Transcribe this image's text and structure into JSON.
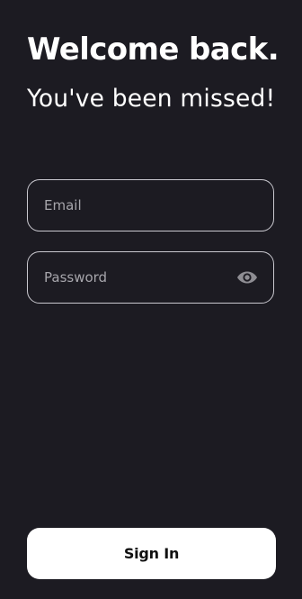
{
  "header": {
    "title": "Welcome back.",
    "subtitle": "You've been missed!"
  },
  "form": {
    "email": {
      "placeholder": "Email",
      "value": ""
    },
    "password": {
      "placeholder": "Password",
      "value": "",
      "toggle_icon": "eye-icon"
    },
    "submit_label": "Sign In"
  },
  "colors": {
    "background": "#1c1b22",
    "text": "#ffffff",
    "field_border": "#c9c8cf",
    "placeholder": "#a6a5ab",
    "icon": "#8e8d93",
    "button_background": "#ffffff",
    "button_text": "#111111"
  }
}
